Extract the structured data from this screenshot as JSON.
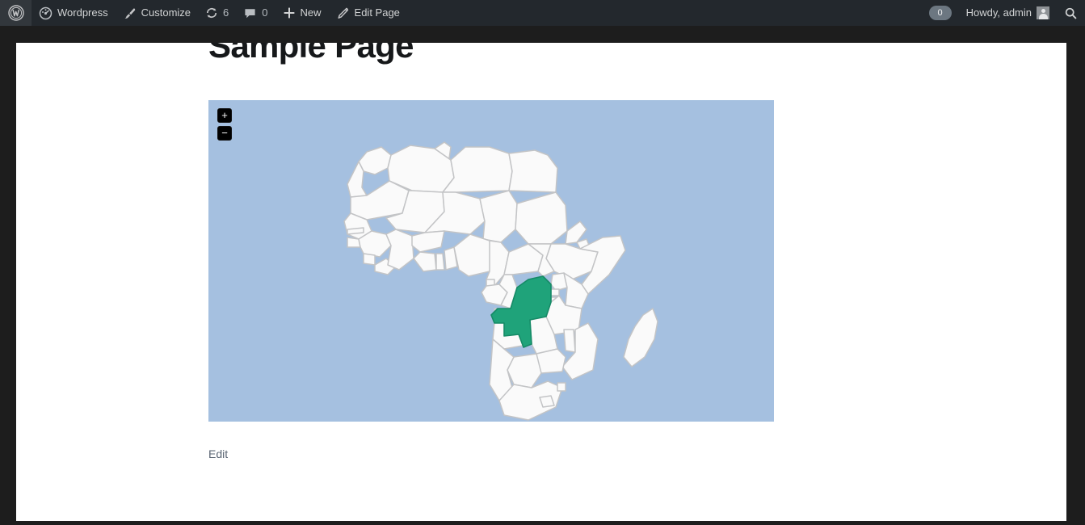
{
  "colors": {
    "adminbar_bg": "#23282d",
    "page_frame": "#1d1d1d",
    "content_bg": "#ffffff",
    "ocean": "#a5c0e0",
    "country_fill": "#fafafa",
    "country_stroke": "#c3c4c6",
    "highlight": "#1fa37a",
    "highlight_stroke": "#158a66",
    "title_color": "#16181a",
    "edit_link_color": "#5a6573"
  },
  "adminbar": {
    "logo": {
      "name": "wordpress-logo",
      "icon": "wordpress-icon"
    },
    "site": {
      "label": "Wordpress",
      "icon": "dashboard-icon"
    },
    "customize": {
      "label": "Customize",
      "icon": "paintbrush-icon"
    },
    "updates": {
      "count": "6",
      "icon": "updates-icon"
    },
    "comments": {
      "count": "0",
      "icon": "comment-bubble-icon"
    },
    "new": {
      "label": "New",
      "icon": "plus-icon"
    },
    "edit_page": {
      "label": "Edit Page",
      "icon": "pencil-icon"
    },
    "notifications": {
      "count": "0"
    },
    "account": {
      "label": "Howdy, admin",
      "avatar": "user-avatar-icon"
    },
    "search": {
      "icon": "search-icon"
    }
  },
  "entry": {
    "title": "Sample Page",
    "edit_label": "Edit"
  },
  "map": {
    "region": "Africa",
    "zoom_in_label": "+",
    "zoom_out_label": "−",
    "highlighted_country": "Democratic Republic of the Congo"
  }
}
